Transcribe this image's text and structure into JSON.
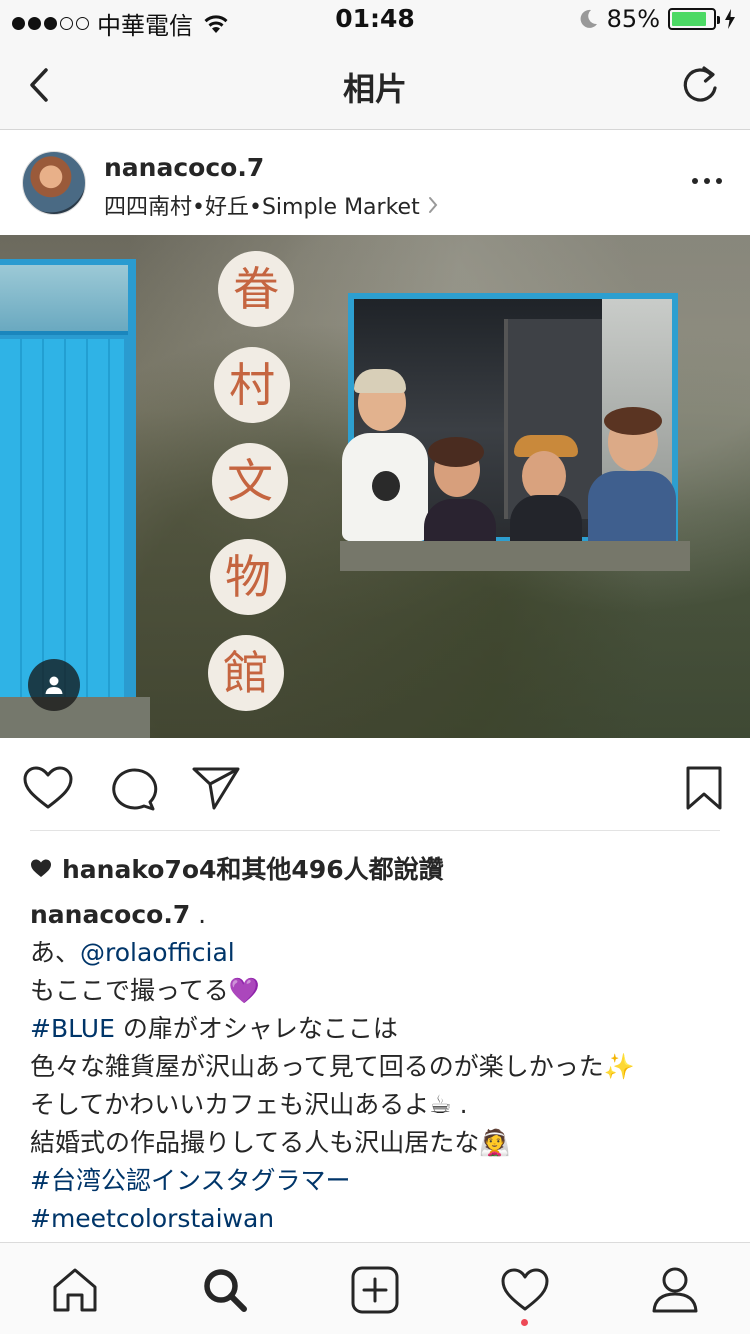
{
  "status_bar": {
    "carrier": "中華電信",
    "signal_dots_filled": 3,
    "signal_dots_total": 5,
    "time": "01:48",
    "battery_percent": "85%",
    "battery_level": 0.85,
    "battery_color": "#4cd964",
    "icons": [
      "wifi-icon",
      "moon-icon",
      "battery-icon",
      "charging-bolt-icon"
    ]
  },
  "nav": {
    "title": "相片",
    "back_icon": "chevron-left-icon",
    "refresh_icon": "refresh-icon"
  },
  "post": {
    "username": "nanacoco.7",
    "location": "四四南村•好丘•Simple Market",
    "more_icon": "more-horizontal-icon",
    "photo": {
      "sign_characters": [
        "眷",
        "村",
        "文",
        "物",
        "館"
      ],
      "tagged_user_icon": "user-tag-icon"
    },
    "actions": [
      "heart-icon",
      "comment-icon",
      "share-icon",
      "bookmark-icon"
    ],
    "likes_text": "hanako7o4和其他496人都說讚",
    "caption": {
      "author": "nanacoco.7",
      "author_suffix": " .",
      "line2_prefix": "あ、",
      "line2_mention": "@rolaofficial",
      "line3": "もここで撮ってる💜",
      "line4_tag": "#BLUE",
      "line4_text": " の扉がオシャレなここは",
      "line5": "色々な雑貨屋が沢山あって見て回るのが楽しかった✨",
      "line6": "そしてかわいいカフェも沢山あるよ☕ .",
      "line7": "結婚式の作品撮りしてる人も沢山居たな👰",
      "line8_tag": "#台湾公認インスタグラマー",
      "line9_tag": "#meetcolorstaiwan"
    }
  },
  "tab_bar": {
    "tabs": [
      "home-icon",
      "search-icon",
      "new-post-icon",
      "activity-icon",
      "profile-icon"
    ],
    "active": "search-icon",
    "notification_dot_color": "#ed4956",
    "link_color": "#003569"
  }
}
